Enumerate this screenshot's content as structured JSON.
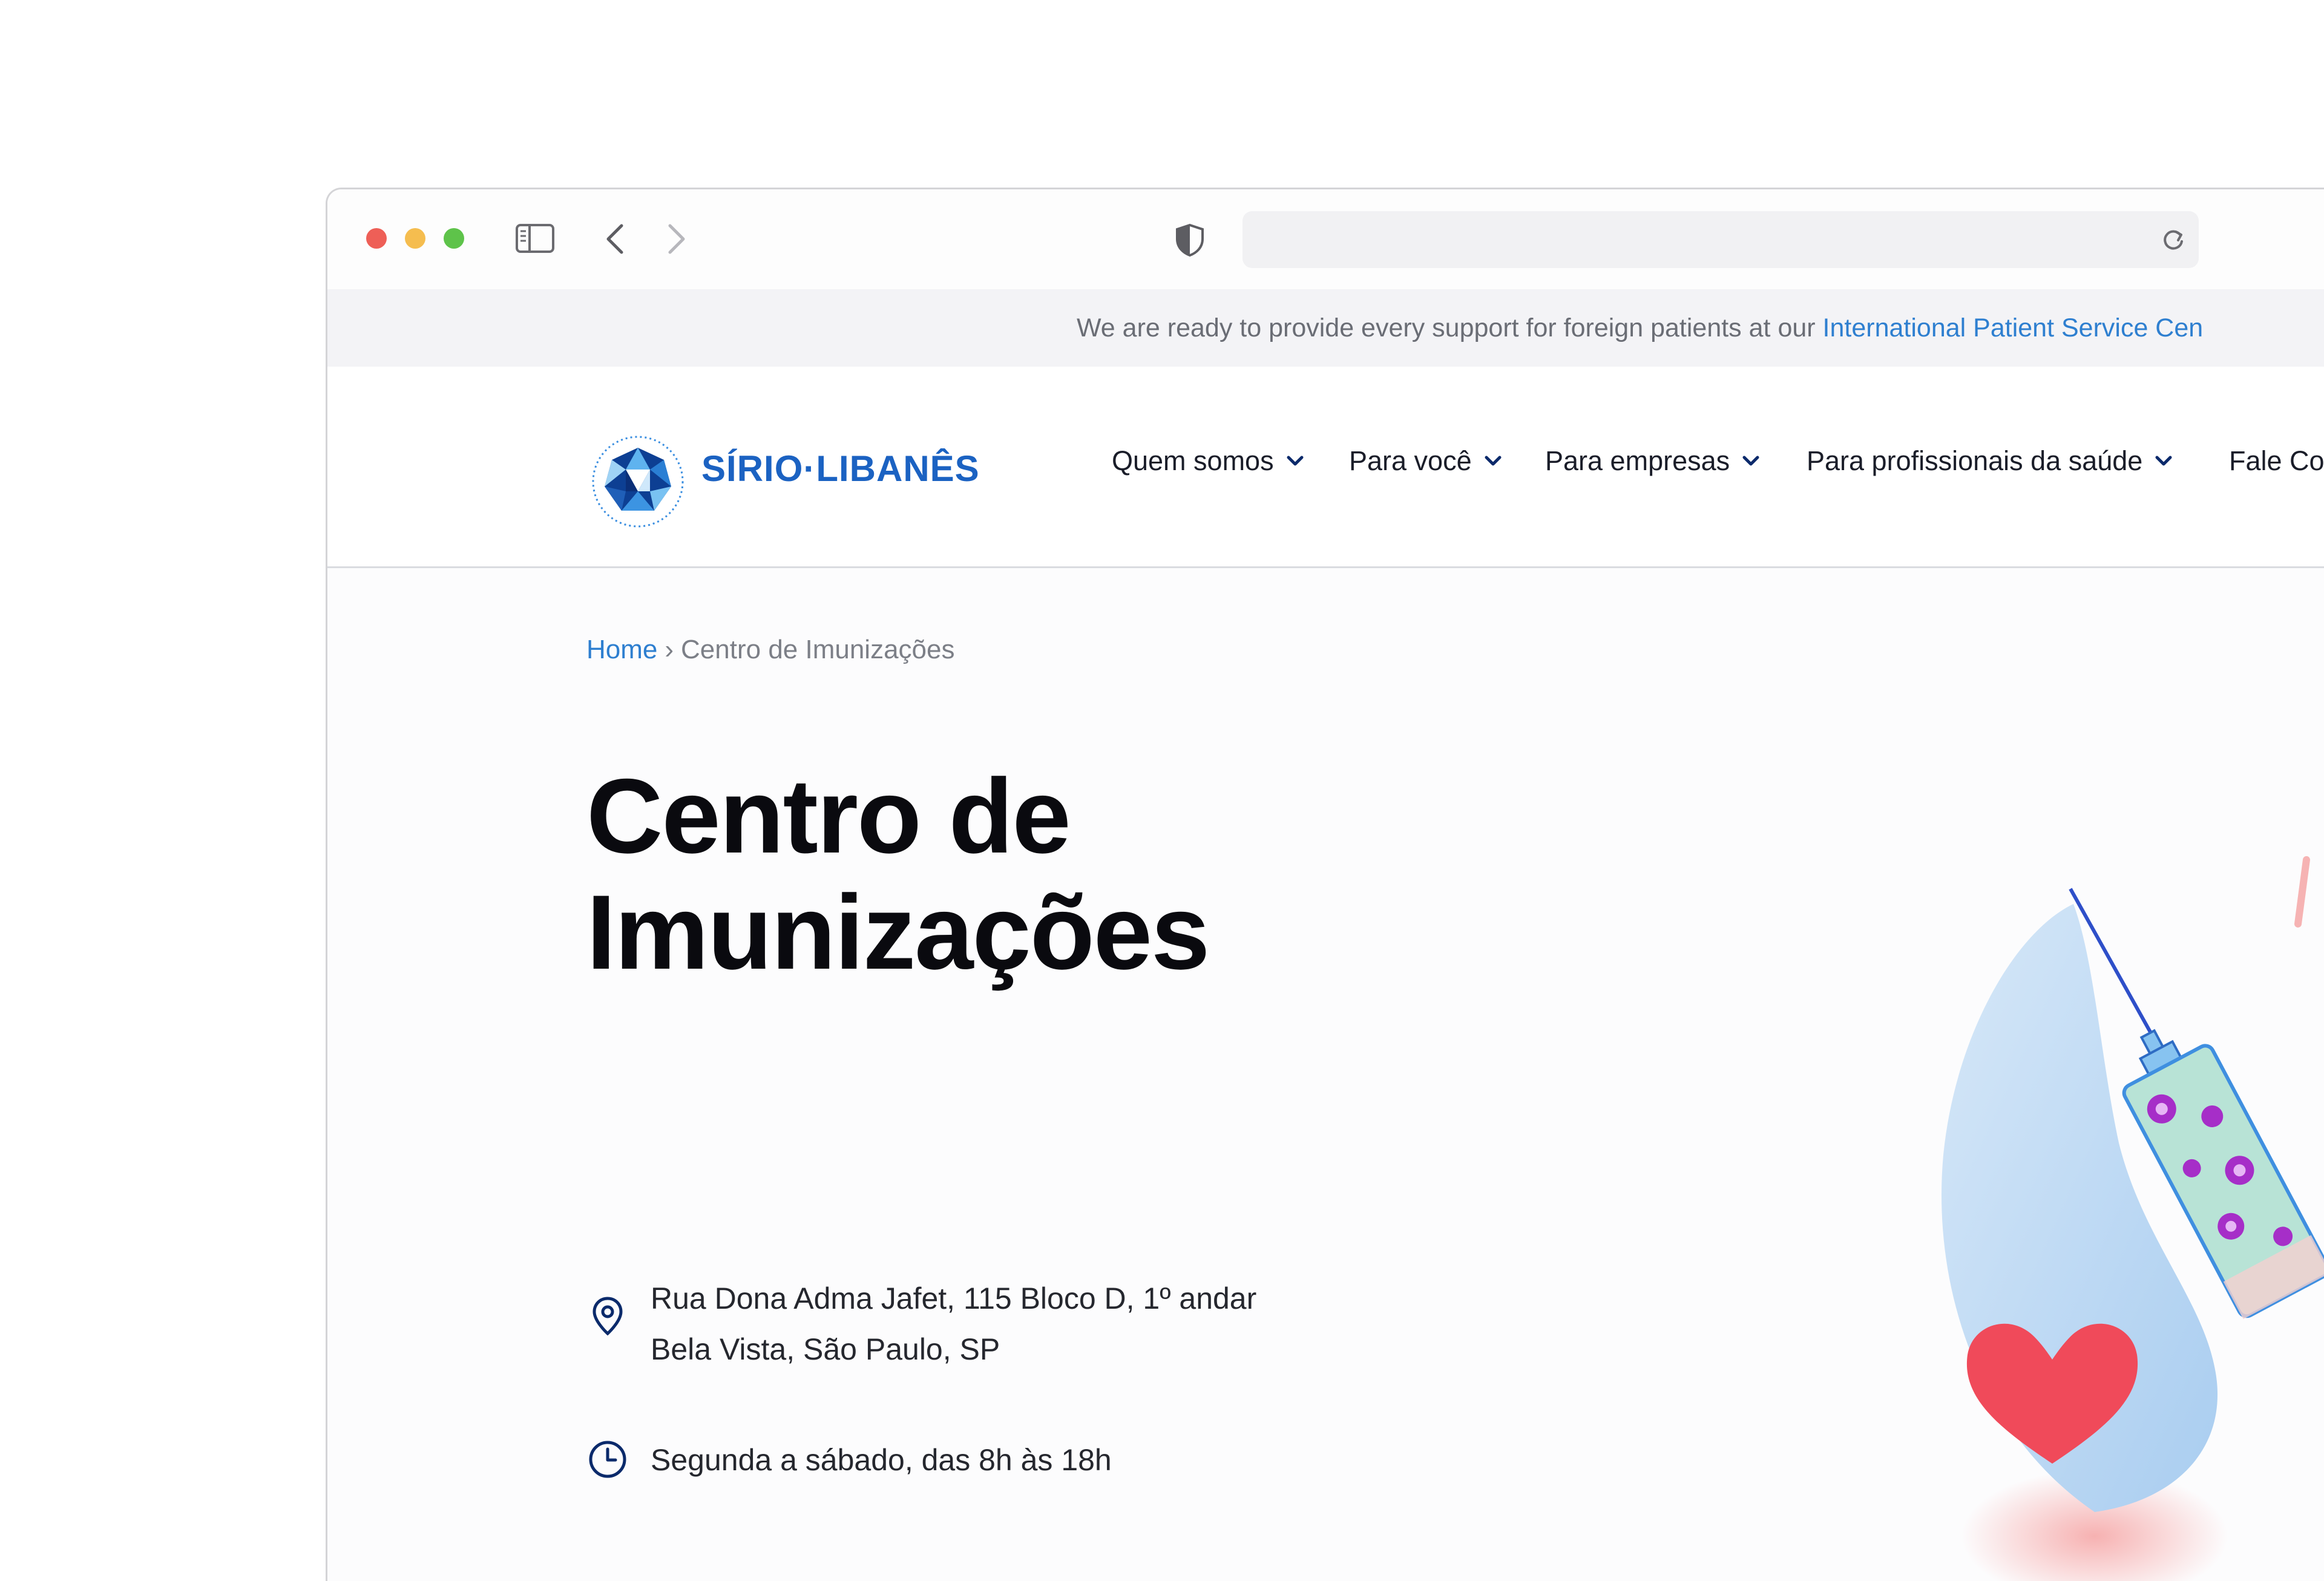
{
  "announcement": {
    "text": "We are ready to provide every support for foreign patients at our ",
    "link_text": "International Patient Service Cen"
  },
  "brand": {
    "name": "SÍRIO·LIBANÊS"
  },
  "nav": {
    "items": [
      {
        "label": "Quem somos"
      },
      {
        "label": "Para você"
      },
      {
        "label": "Para empresas"
      },
      {
        "label": "Para profissionais da saúde"
      },
      {
        "label": "Fale Co"
      }
    ]
  },
  "breadcrumb": {
    "home": "Home",
    "separator": "›",
    "current": "Centro de Imunizações"
  },
  "page": {
    "title_line1": "Centro de",
    "title_line2": "Imunizações",
    "address_line1": "Rua Dona Adma Jafet, 115 Bloco D, 1º andar",
    "address_line2": "Bela Vista, São Paulo, SP",
    "hours": "Segunda a sábado, das 8h às 18h"
  },
  "icons": {
    "location": "map-pin-icon",
    "clock": "clock-icon",
    "chevron": "chevron-down-icon",
    "shield": "shield-icon",
    "reload": "reload-icon",
    "sidebar": "sidebar-icon",
    "back": "back-arrow-icon",
    "forward": "forward-arrow-icon"
  },
  "colors": {
    "accent_blue": "#1b62c2",
    "link_blue": "#2e7fd0",
    "dark_navy": "#0b2a6b",
    "heart_red": "#f04a5a",
    "drop_blue": "#cfe3f7"
  }
}
